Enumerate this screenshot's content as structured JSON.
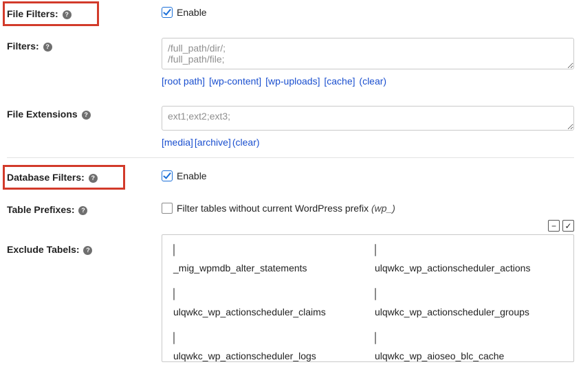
{
  "file_filters": {
    "heading": "File Filters:",
    "enable_label": "Enable",
    "enabled": true
  },
  "filters": {
    "label": "Filters:",
    "placeholder": "/full_path/dir/;\n/full_path/file;",
    "value": "",
    "links": [
      "[root path]",
      "[wp-content]",
      "[wp-uploads]",
      "[cache]",
      "(clear)"
    ]
  },
  "file_extensions": {
    "label": "File Extensions",
    "placeholder": "ext1;ext2;ext3;",
    "value": "",
    "links": [
      "[media]",
      "[archive]",
      "(clear)"
    ]
  },
  "database_filters": {
    "heading": "Database Filters:",
    "enable_label": "Enable",
    "enabled": true
  },
  "table_prefixes": {
    "label": "Table Prefixes:",
    "checkbox_label": "Filter tables without current WordPress prefix ",
    "prefix_note": "(wp_)",
    "checked": false
  },
  "exclude_tables": {
    "label": "Exclude Tabels:",
    "toggle": {
      "collapse_symbol": "−",
      "check_symbol": "✓"
    },
    "items": [
      "_mig_wpmdb_alter_statements",
      "ulqwkc_wp_actionscheduler_actions",
      "ulqwkc_wp_actionscheduler_claims",
      "ulqwkc_wp_actionscheduler_groups",
      "ulqwkc_wp_actionscheduler_logs",
      "ulqwkc_wp_aioseo_blc_cache"
    ]
  }
}
